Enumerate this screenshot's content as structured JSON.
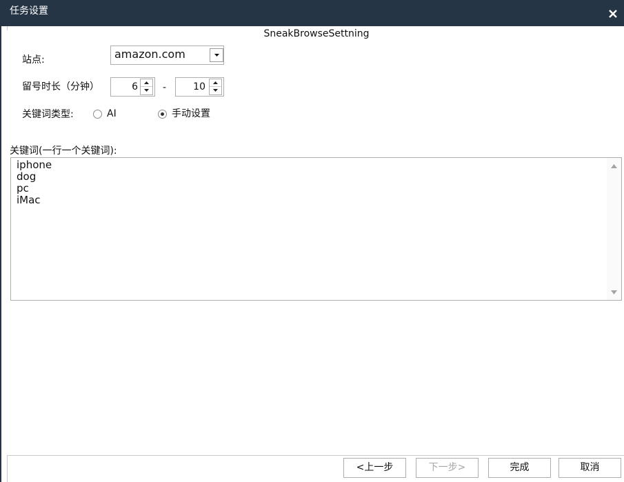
{
  "window": {
    "title": "任务设置",
    "close_icon": "close-icon"
  },
  "colors": {
    "titlebar_bg": "#253545",
    "titlebar_text": "#ffffff",
    "border": "#abadb3",
    "disabled_text": "#a6a6a6"
  },
  "heading": "SneakBrowseSettning",
  "form": {
    "site": {
      "label": "站点:",
      "value": "amazon.com",
      "icon": "chevron-down-icon"
    },
    "duration": {
      "label": "留号时长（分钟）",
      "min": 6,
      "separator": "-",
      "max": 10
    },
    "keyword_type": {
      "label": "关键词类型:",
      "options": [
        {
          "label": "AI",
          "checked": false
        },
        {
          "label": "手动设置",
          "checked": true
        }
      ]
    },
    "keywords": {
      "label": "关键词(一行一个关键词):",
      "lines": [
        "iphone",
        "dog",
        "pc",
        "iMac"
      ]
    }
  },
  "footer": {
    "prev": {
      "label": "<上一步",
      "disabled": false
    },
    "next": {
      "label": "下一步>",
      "disabled": true
    },
    "finish": {
      "label": "完成",
      "disabled": false
    },
    "cancel": {
      "label": "取消",
      "disabled": false
    }
  }
}
